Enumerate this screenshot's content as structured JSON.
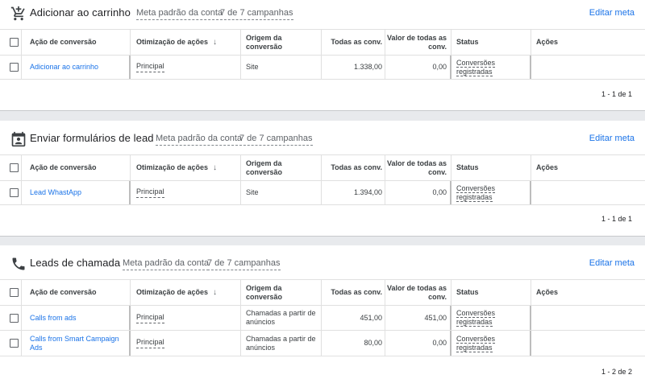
{
  "columns": {
    "conversion_action": "Ação de conversão",
    "optimization": "Otimização de ações",
    "sort_icon": "↓",
    "origin": "Origem da conversão",
    "all_conv": "Todas as conv.",
    "value_all": "Valor de todas as conv.",
    "status": "Status",
    "actions": "Ações"
  },
  "sections": [
    {
      "icon": "cart-add-icon",
      "title": "Adicionar ao carrinho",
      "meta": "Meta padrão da conta",
      "campaigns": "7 de 7 campanhas",
      "edit": "Editar meta",
      "rows": [
        {
          "name": "Adicionar ao carrinho",
          "optimization": "Principal",
          "origin": "Site",
          "all_conv": "1.338,00",
          "value": "0,00",
          "status": "Conversões registradas"
        }
      ],
      "pager": "1 - 1 de 1"
    },
    {
      "icon": "contact-form-icon",
      "title": "Enviar formulários de lead",
      "meta": "Meta padrão da conta",
      "campaigns": "7 de 7 campanhas",
      "edit": "Editar meta",
      "rows": [
        {
          "name": "Lead WhastApp",
          "optimization": "Principal",
          "origin": "Site",
          "all_conv": "1.394,00",
          "value": "0,00",
          "status": "Conversões registradas"
        }
      ],
      "pager": "1 - 1 de 1"
    },
    {
      "icon": "phone-icon",
      "title": "Leads de chamada",
      "meta": "Meta padrão da conta",
      "campaigns": "7 de 7 campanhas",
      "edit": "Editar meta",
      "rows": [
        {
          "name": "Calls from ads",
          "optimization": "Principal",
          "origin": "Chamadas a partir de anúncios",
          "all_conv": "451,00",
          "value": "451,00",
          "status": "Conversões registradas"
        },
        {
          "name": "Calls from Smart Campaign Ads",
          "optimization": "Principal",
          "origin": "Chamadas a partir de anúncios",
          "all_conv": "80,00",
          "value": "0,00",
          "status": "Conversões registradas"
        }
      ],
      "pager": "1 - 2 de 2"
    }
  ]
}
